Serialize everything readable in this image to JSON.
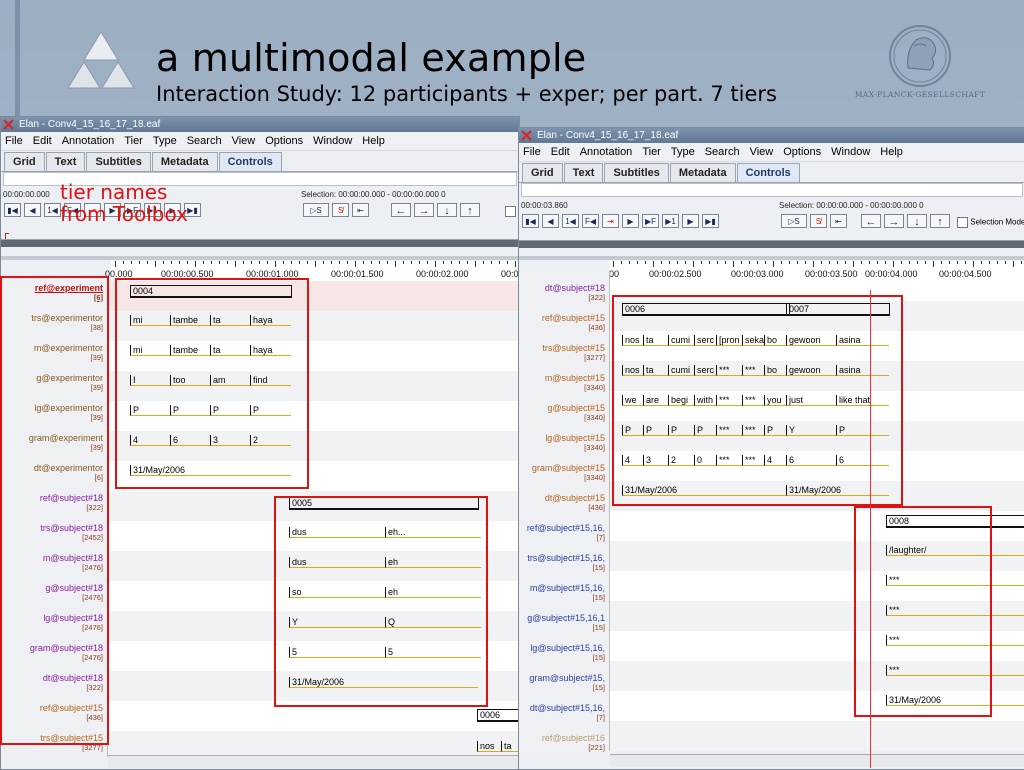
{
  "slide": {
    "title": "a multimodal example",
    "subtitle": "Interaction Study: 12 participants + exper; per part. 7 tiers",
    "logo_text": "MAX-PLANCK-GESELLSCHAFT",
    "annotation": "tier names\nfrom Toolbox"
  },
  "left_window": {
    "title": "Elan - Conv4_15_16_17_18.eaf",
    "menu": [
      "File",
      "Edit",
      "Annotation",
      "Tier",
      "Type",
      "Search",
      "View",
      "Options",
      "Window",
      "Help"
    ],
    "tabs": [
      "Grid",
      "Text",
      "Subtitles",
      "Metadata",
      "Controls"
    ],
    "active_tab": "Controls",
    "time": "00:00:00.000",
    "selection": "Selection: 00:00:00.000 - 00:00:00.000  0",
    "ruler": [
      "00.000",
      "00:00:00.500",
      "00:00:01.000",
      "00:00:01.500",
      "00:00:02.000",
      "00:0"
    ],
    "tiers": [
      {
        "name": "ref@experiment",
        "count": "[6]",
        "color": "#c01010"
      },
      {
        "name": "trs@experimentor",
        "count": "[38]",
        "color": "#8b5a1a"
      },
      {
        "name": "m@experimentor",
        "count": "[39]",
        "color": "#8b5a1a"
      },
      {
        "name": "g@experimentor",
        "count": "[39]",
        "color": "#8b5a1a"
      },
      {
        "name": "lg@experimentor",
        "count": "[39]",
        "color": "#8b5a1a"
      },
      {
        "name": "gram@experiment",
        "count": "[39]",
        "color": "#8b5a1a"
      },
      {
        "name": "dt@experimentor",
        "count": "[6]",
        "color": "#8b5a1a"
      },
      {
        "name": "ref@subject#18",
        "count": "[322]",
        "color": "#8a1fa0"
      },
      {
        "name": "trs@subject#18",
        "count": "[2452]",
        "color": "#8a1fa0"
      },
      {
        "name": "m@subject#18",
        "count": "[2476]",
        "color": "#8a1fa0"
      },
      {
        "name": "g@subject#18",
        "count": "[2476]",
        "color": "#8a1fa0"
      },
      {
        "name": "lg@subject#18",
        "count": "[2476]",
        "color": "#8a1fa0"
      },
      {
        "name": "gram@subject#18",
        "count": "[2476]",
        "color": "#8a1fa0"
      },
      {
        "name": "dt@subject#18",
        "count": "[322]",
        "color": "#8a1fa0"
      },
      {
        "name": "ref@subject#15",
        "count": "[436]",
        "color": "#b5651d"
      },
      {
        "name": "trs@subject#15",
        "count": "[3277]",
        "color": "#b5651d"
      }
    ],
    "block1": {
      "id": "0004",
      "rows": [
        [
          "mi",
          "tambe",
          "ta",
          "haya"
        ],
        [
          "mi",
          "tambe",
          "ta",
          "haya"
        ],
        [
          "I",
          "too",
          "am",
          "find"
        ],
        [
          "P",
          "P",
          "P",
          "P"
        ],
        [
          "4",
          "6",
          "3",
          "2"
        ],
        [
          "31/May/2006"
        ]
      ]
    },
    "block2": {
      "id": "0005",
      "rows": [
        [
          "dus",
          "eh..."
        ],
        [
          "dus",
          "eh"
        ],
        [
          "so",
          "eh"
        ],
        [
          "Y",
          "Q"
        ],
        [
          "5",
          "5"
        ],
        [
          "31/May/2006"
        ]
      ]
    },
    "block3": {
      "id": "0006",
      "rows": [
        [
          "nos",
          "ta"
        ]
      ]
    }
  },
  "right_window": {
    "title": "Elan - Conv4_15_16_17_18.eaf",
    "menu": [
      "File",
      "Edit",
      "Annotation",
      "Tier",
      "Type",
      "Search",
      "View",
      "Options",
      "Window",
      "Help"
    ],
    "tabs": [
      "Grid",
      "Text",
      "Subtitles",
      "Metadata",
      "Controls"
    ],
    "active_tab": "Controls",
    "time": "00:00:03.860",
    "selection": "Selection: 00:00:00.000 - 00:00:00.000  0",
    "selection_mode": "Selection Mode",
    "ruler": [
      "00",
      "00:00:02.500",
      "00:00:03.000",
      "00:00:03.500",
      "00:00:04.000",
      "00:00:04.500"
    ],
    "tiers": [
      {
        "name": "dt@subject#18",
        "count": "[322]",
        "color": "#8a1fa0"
      },
      {
        "name": "ref@subject#15",
        "count": "[436]",
        "color": "#b5651d"
      },
      {
        "name": "trs@subject#15",
        "count": "[3277]",
        "color": "#b5651d"
      },
      {
        "name": "m@subject#15",
        "count": "[3340]",
        "color": "#b5651d"
      },
      {
        "name": "g@subject#15",
        "count": "[3340]",
        "color": "#b5651d"
      },
      {
        "name": "lg@subject#15",
        "count": "[3340]",
        "color": "#b5651d"
      },
      {
        "name": "gram@subject#15",
        "count": "[3340]",
        "color": "#b5651d"
      },
      {
        "name": "dt@subject#15",
        "count": "[436]",
        "color": "#b5651d"
      },
      {
        "name": "ref@subject#15,16,",
        "count": "[7]",
        "color": "#2a3fa0"
      },
      {
        "name": "trs@subject#15,16,",
        "count": "[15]",
        "color": "#2a3fa0"
      },
      {
        "name": "m@subject#15,16,",
        "count": "[15]",
        "color": "#2a3fa0"
      },
      {
        "name": "g@subject#15,16,1",
        "count": "[15]",
        "color": "#2a3fa0"
      },
      {
        "name": "lg@subject#15,16,",
        "count": "[15]",
        "color": "#2a3fa0"
      },
      {
        "name": "gram@subject#15,",
        "count": "[15]",
        "color": "#2a3fa0"
      },
      {
        "name": "dt@subject#15,16,",
        "count": "[7]",
        "color": "#2a3fa0"
      },
      {
        "name": "ref@subject#16",
        "count": "[221]",
        "color": "#b5a070"
      }
    ],
    "block1": {
      "ids": [
        "0006",
        "0007"
      ],
      "rows": [
        [
          "nos",
          "ta",
          "cumi",
          "serc",
          "[pron",
          "seka",
          "bo",
          "gewoon",
          "asina"
        ],
        [
          "nos",
          "ta",
          "cumi",
          "serc",
          "***",
          "***",
          "bo",
          "gewoon",
          "asina"
        ],
        [
          "we",
          "are",
          "begi",
          "with",
          "***",
          "***",
          "you",
          "just",
          "like that"
        ],
        [
          "P",
          "P",
          "P",
          "P",
          "***",
          "***",
          "P",
          "Y",
          "P"
        ],
        [
          "4",
          "3",
          "2",
          "0",
          "***",
          "***",
          "4",
          "6",
          "6"
        ],
        [
          "31/May/2006",
          "31/May/2006"
        ]
      ]
    },
    "block2": {
      "id": "0008",
      "rows": [
        [
          "/laughter/"
        ],
        [
          "***"
        ],
        [
          "***"
        ],
        [
          "***"
        ],
        [
          "***"
        ],
        [
          "31/May/2006"
        ]
      ]
    }
  }
}
